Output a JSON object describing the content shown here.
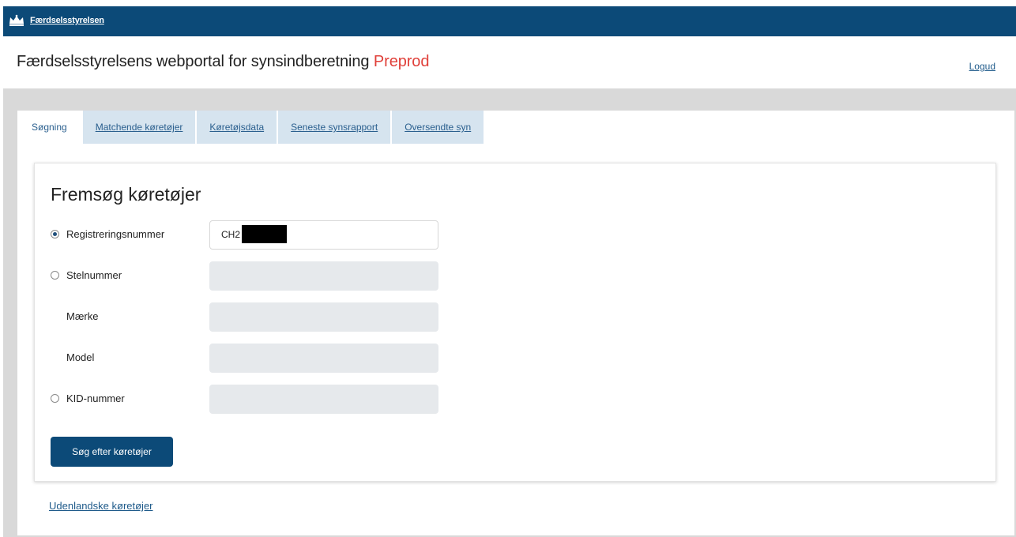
{
  "header": {
    "brand": "Færdselsstyrelsen",
    "title_main": "Færdselsstyrelsens webportal for synsindberetning",
    "title_env": "Preprod",
    "logout": "Logud"
  },
  "tabs": [
    {
      "label": "Søgning",
      "active": true
    },
    {
      "label": "Matchende køretøjer",
      "active": false
    },
    {
      "label": "Køretøjsdata",
      "active": false
    },
    {
      "label": "Seneste synsrapport",
      "active": false
    },
    {
      "label": "Oversendte syn",
      "active": false
    }
  ],
  "search": {
    "heading": "Fremsøg køretøjer",
    "fields": [
      {
        "label": "Registreringsnummer",
        "value": "CH2",
        "radio": true,
        "checked": true,
        "redacted": true
      },
      {
        "label": "Stelnummer",
        "value": "",
        "radio": true,
        "checked": false
      },
      {
        "label": "Mærke",
        "value": "",
        "radio": false
      },
      {
        "label": "Model",
        "value": "",
        "radio": false
      },
      {
        "label": "KID-nummer",
        "value": "",
        "radio": true,
        "checked": false
      }
    ],
    "button": "Søg efter køretøjer"
  },
  "footer_link": "Udenlandske køretøjer",
  "colors": {
    "brand_blue": "#0c4a78",
    "env_red": "#e0403a",
    "link_blue": "#1e5a8a"
  }
}
